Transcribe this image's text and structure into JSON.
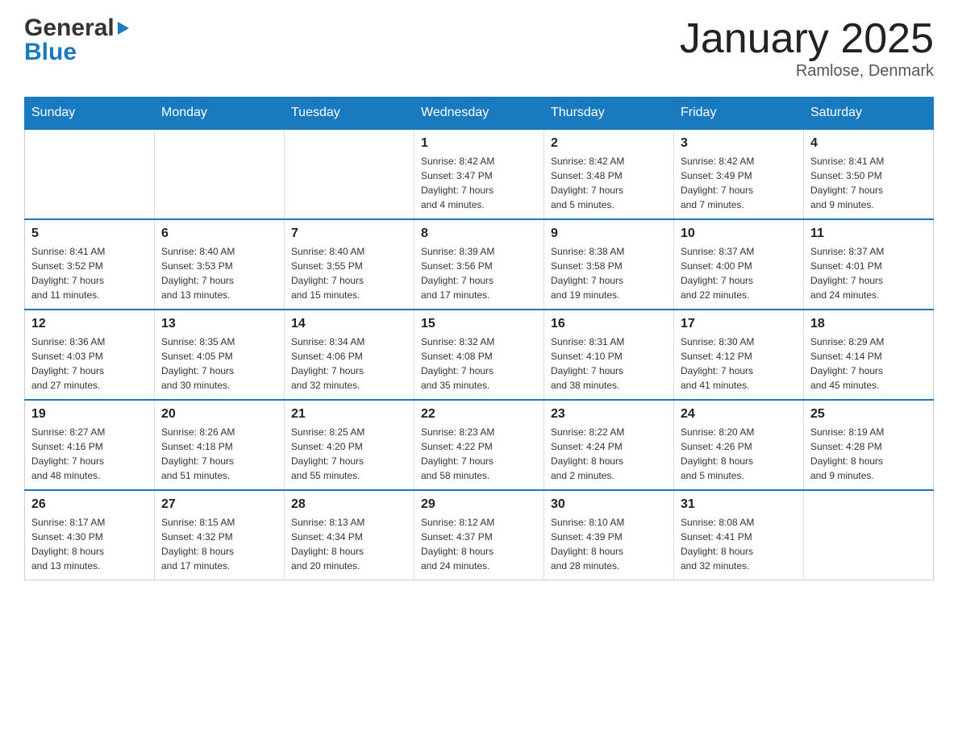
{
  "logo": {
    "general": "General",
    "blue": "Blue"
  },
  "title": "January 2025",
  "subtitle": "Ramlose, Denmark",
  "weekdays": [
    "Sunday",
    "Monday",
    "Tuesday",
    "Wednesday",
    "Thursday",
    "Friday",
    "Saturday"
  ],
  "weeks": [
    [
      {
        "day": "",
        "info": ""
      },
      {
        "day": "",
        "info": ""
      },
      {
        "day": "",
        "info": ""
      },
      {
        "day": "1",
        "info": "Sunrise: 8:42 AM\nSunset: 3:47 PM\nDaylight: 7 hours\nand 4 minutes."
      },
      {
        "day": "2",
        "info": "Sunrise: 8:42 AM\nSunset: 3:48 PM\nDaylight: 7 hours\nand 5 minutes."
      },
      {
        "day": "3",
        "info": "Sunrise: 8:42 AM\nSunset: 3:49 PM\nDaylight: 7 hours\nand 7 minutes."
      },
      {
        "day": "4",
        "info": "Sunrise: 8:41 AM\nSunset: 3:50 PM\nDaylight: 7 hours\nand 9 minutes."
      }
    ],
    [
      {
        "day": "5",
        "info": "Sunrise: 8:41 AM\nSunset: 3:52 PM\nDaylight: 7 hours\nand 11 minutes."
      },
      {
        "day": "6",
        "info": "Sunrise: 8:40 AM\nSunset: 3:53 PM\nDaylight: 7 hours\nand 13 minutes."
      },
      {
        "day": "7",
        "info": "Sunrise: 8:40 AM\nSunset: 3:55 PM\nDaylight: 7 hours\nand 15 minutes."
      },
      {
        "day": "8",
        "info": "Sunrise: 8:39 AM\nSunset: 3:56 PM\nDaylight: 7 hours\nand 17 minutes."
      },
      {
        "day": "9",
        "info": "Sunrise: 8:38 AM\nSunset: 3:58 PM\nDaylight: 7 hours\nand 19 minutes."
      },
      {
        "day": "10",
        "info": "Sunrise: 8:37 AM\nSunset: 4:00 PM\nDaylight: 7 hours\nand 22 minutes."
      },
      {
        "day": "11",
        "info": "Sunrise: 8:37 AM\nSunset: 4:01 PM\nDaylight: 7 hours\nand 24 minutes."
      }
    ],
    [
      {
        "day": "12",
        "info": "Sunrise: 8:36 AM\nSunset: 4:03 PM\nDaylight: 7 hours\nand 27 minutes."
      },
      {
        "day": "13",
        "info": "Sunrise: 8:35 AM\nSunset: 4:05 PM\nDaylight: 7 hours\nand 30 minutes."
      },
      {
        "day": "14",
        "info": "Sunrise: 8:34 AM\nSunset: 4:06 PM\nDaylight: 7 hours\nand 32 minutes."
      },
      {
        "day": "15",
        "info": "Sunrise: 8:32 AM\nSunset: 4:08 PM\nDaylight: 7 hours\nand 35 minutes."
      },
      {
        "day": "16",
        "info": "Sunrise: 8:31 AM\nSunset: 4:10 PM\nDaylight: 7 hours\nand 38 minutes."
      },
      {
        "day": "17",
        "info": "Sunrise: 8:30 AM\nSunset: 4:12 PM\nDaylight: 7 hours\nand 41 minutes."
      },
      {
        "day": "18",
        "info": "Sunrise: 8:29 AM\nSunset: 4:14 PM\nDaylight: 7 hours\nand 45 minutes."
      }
    ],
    [
      {
        "day": "19",
        "info": "Sunrise: 8:27 AM\nSunset: 4:16 PM\nDaylight: 7 hours\nand 48 minutes."
      },
      {
        "day": "20",
        "info": "Sunrise: 8:26 AM\nSunset: 4:18 PM\nDaylight: 7 hours\nand 51 minutes."
      },
      {
        "day": "21",
        "info": "Sunrise: 8:25 AM\nSunset: 4:20 PM\nDaylight: 7 hours\nand 55 minutes."
      },
      {
        "day": "22",
        "info": "Sunrise: 8:23 AM\nSunset: 4:22 PM\nDaylight: 7 hours\nand 58 minutes."
      },
      {
        "day": "23",
        "info": "Sunrise: 8:22 AM\nSunset: 4:24 PM\nDaylight: 8 hours\nand 2 minutes."
      },
      {
        "day": "24",
        "info": "Sunrise: 8:20 AM\nSunset: 4:26 PM\nDaylight: 8 hours\nand 5 minutes."
      },
      {
        "day": "25",
        "info": "Sunrise: 8:19 AM\nSunset: 4:28 PM\nDaylight: 8 hours\nand 9 minutes."
      }
    ],
    [
      {
        "day": "26",
        "info": "Sunrise: 8:17 AM\nSunset: 4:30 PM\nDaylight: 8 hours\nand 13 minutes."
      },
      {
        "day": "27",
        "info": "Sunrise: 8:15 AM\nSunset: 4:32 PM\nDaylight: 8 hours\nand 17 minutes."
      },
      {
        "day": "28",
        "info": "Sunrise: 8:13 AM\nSunset: 4:34 PM\nDaylight: 8 hours\nand 20 minutes."
      },
      {
        "day": "29",
        "info": "Sunrise: 8:12 AM\nSunset: 4:37 PM\nDaylight: 8 hours\nand 24 minutes."
      },
      {
        "day": "30",
        "info": "Sunrise: 8:10 AM\nSunset: 4:39 PM\nDaylight: 8 hours\nand 28 minutes."
      },
      {
        "day": "31",
        "info": "Sunrise: 8:08 AM\nSunset: 4:41 PM\nDaylight: 8 hours\nand 32 minutes."
      },
      {
        "day": "",
        "info": ""
      }
    ]
  ]
}
